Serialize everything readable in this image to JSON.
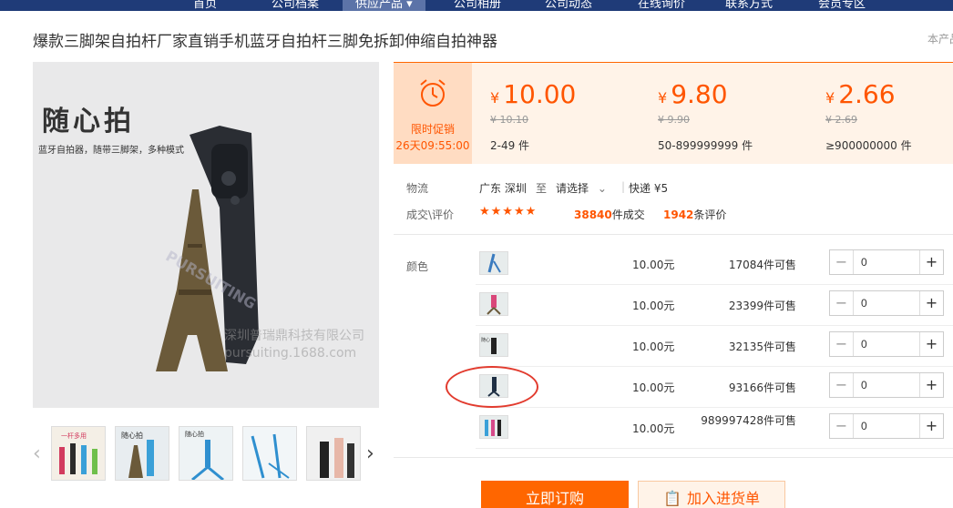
{
  "nav": {
    "items": [
      "首页",
      "公司档案",
      "供应产品",
      "公司相册",
      "公司动态",
      "在线询价",
      "联系方式",
      "会员专区"
    ]
  },
  "product": {
    "title": "爆款三脚架自拍杆厂家直销手机蓝牙自拍杆三脚免拆卸伸缩自拍神器",
    "right_edge_text": "本产品",
    "image_brand": "随心拍",
    "image_tagline": "蓝牙自拍器，随带三脚架，多种模式",
    "image_watermark_company": "深圳普瑞鼎科技有限公司",
    "image_watermark_url": "pursuiting.1688.com",
    "image_watermark_logo": "PURSUITING"
  },
  "promo": {
    "label": "限时促销",
    "countdown": "26天09:55:00"
  },
  "tiers": [
    {
      "symbol": "¥",
      "price": "10.00",
      "old": "¥ 10.10",
      "qty": "2-49 件"
    },
    {
      "symbol": "¥",
      "price": "9.80",
      "old": "¥ 9.90",
      "qty": "50-899999999 件"
    },
    {
      "symbol": "¥",
      "price": "2.66",
      "old": "¥ 2.69",
      "qty": "≥900000000 件"
    }
  ],
  "logistics": {
    "label": "物流",
    "origin": "广东 深圳",
    "to": "至",
    "dest": "请选择",
    "shipping": "快递 ¥5"
  },
  "reviews": {
    "label": "成交\\评价",
    "stars": "★★★★★",
    "deals": "38840",
    "deals_unit": "件成交",
    "reviews": "1942",
    "reviews_unit": "条评价"
  },
  "sku": {
    "label": "颜色",
    "rows": [
      {
        "price": "10.00元",
        "stock": "17084件可售",
        "qty": "0",
        "color": "#3a7bbf"
      },
      {
        "price": "10.00元",
        "stock": "23399件可售",
        "qty": "0",
        "color": "#d9477a"
      },
      {
        "price": "10.00元",
        "stock": "32135件可售",
        "qty": "0",
        "color": "#222222"
      },
      {
        "price": "10.00元",
        "stock": "93166件可售",
        "qty": "0",
        "color": "#1f2f44"
      },
      {
        "price": "10.00元",
        "stock": "989997428件可售",
        "qty": "0",
        "color": "#d64a8a"
      }
    ]
  },
  "actions": {
    "order": "立即订购",
    "cart": "加入进货单"
  },
  "colors": {
    "accent": "#ff6600",
    "nav_bg": "#1f3b78",
    "highlight": "#e23b2e"
  }
}
